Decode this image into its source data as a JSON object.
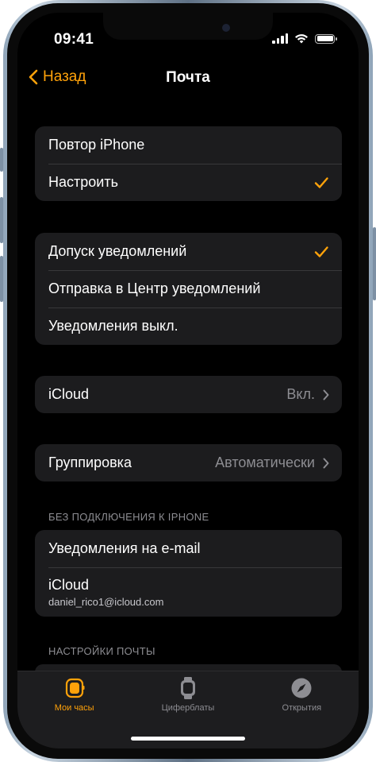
{
  "status_bar": {
    "time": "09:41"
  },
  "nav": {
    "back_label": "Назад",
    "title": "Почта"
  },
  "mirror_group": {
    "items": [
      {
        "label": "Повтор iPhone",
        "checked": false
      },
      {
        "label": "Настроить",
        "checked": true
      }
    ]
  },
  "alerts_group": {
    "items": [
      {
        "label": "Допуск уведомлений",
        "checked": true
      },
      {
        "label": "Отправка в Центр уведомлений",
        "checked": false
      },
      {
        "label": "Уведомления выкл.",
        "checked": false
      }
    ]
  },
  "icloud_row": {
    "label": "iCloud",
    "value": "Вкл."
  },
  "grouping_row": {
    "label": "Группировка",
    "value": "Автоматически"
  },
  "offline_section": {
    "header": "БЕЗ ПОДКЛЮЧЕНИЯ К IPHONE",
    "items": [
      {
        "label": "Уведомления на e-mail"
      },
      {
        "label": "iCloud",
        "sublabel": "daniel_rico1@icloud.com"
      }
    ]
  },
  "mail_settings_section": {
    "header": "НАСТРОЙКИ ПОЧТЫ"
  },
  "tabbar": {
    "tabs": [
      {
        "label": "Мои часы",
        "icon": "watch-icon",
        "active": true
      },
      {
        "label": "Циферблаты",
        "icon": "watch-faces-icon",
        "active": false
      },
      {
        "label": "Открытия",
        "icon": "compass-icon",
        "active": false
      }
    ]
  },
  "colors": {
    "accent": "#ffa20a",
    "background": "#000000",
    "cell": "#1c1c1e",
    "secondary_text": "#8d8d92"
  }
}
